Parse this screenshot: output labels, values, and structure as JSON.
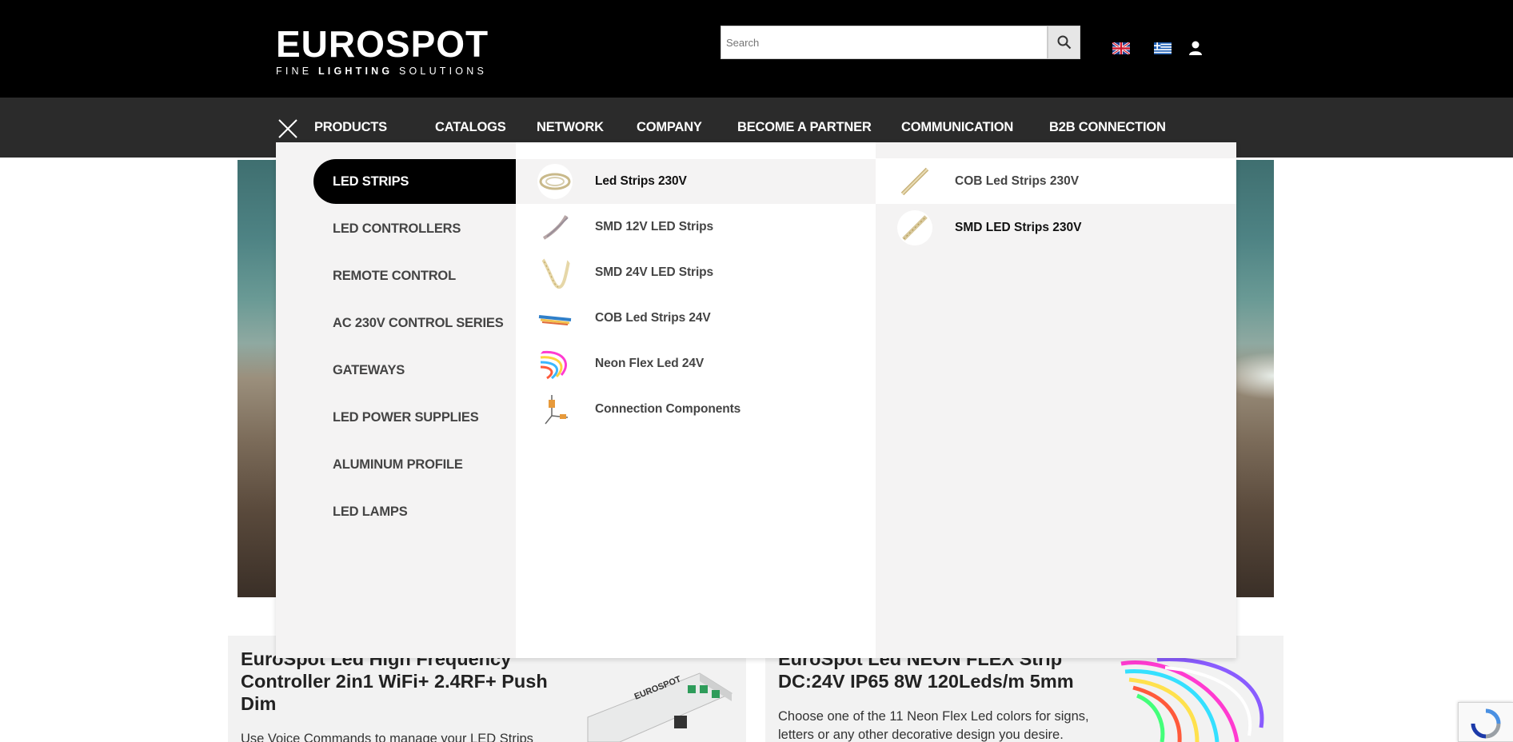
{
  "header": {
    "logo_main": "EUROSPOT",
    "logo_sub_before": "FINE ",
    "logo_sub_bold": "LIGHTING",
    "logo_sub_after": " SOLUTIONS",
    "search_placeholder": "Search",
    "search_icon": "magnifier-icon",
    "languages": [
      "en",
      "el"
    ],
    "user_icon": "user-icon"
  },
  "nav": {
    "close_icon": "close-icon",
    "items": [
      "PRODUCTS",
      "CATALOGS",
      "NETWORK",
      "COMPANY",
      "BECOME A PARTNER",
      "COMMUNICATION",
      "B2B CONNECTION"
    ]
  },
  "mega_menu": {
    "categories": [
      "LED STRIPS",
      "LED CONTROLLERS",
      "REMOTE CONTROL",
      "AC 230V CONTROL SERIES",
      "GATEWAYS",
      "LED POWER SUPPLIES",
      "ALUMINUM PROFILE",
      "LED LAMPS"
    ],
    "active_category": "LED STRIPS",
    "subcategories": [
      "Led Strips 230V",
      "SMD 12V LED Strips",
      "SMD 24V LED Strips",
      "COB Led Strips 24V",
      "Neon Flex Led 24V",
      "Connection Components"
    ],
    "active_subcategory": "Led Strips 230V",
    "third_level": [
      "COB Led Strips 230V",
      "SMD LED Strips 230V"
    ]
  },
  "cards": [
    {
      "title": "EuroSpot Led High Frequency Controller 2in1 WiFi+ 2.4RF+ Push Dim",
      "text": "Use Voice Commands to manage your LED Strips"
    },
    {
      "title": "EuroSpot Led NEON FLEX Strip DC:24V IP65 8W 120Leds/m 5mm",
      "text": "Choose one of the 11 Neon Flex Led colors for signs, letters or any other decorative design you desire."
    }
  ],
  "colors": {
    "header_bg": "#000000",
    "nav_bg": "#2b2b2b",
    "menu_bg": "#f4f3f3",
    "active_bg": "#000000"
  }
}
